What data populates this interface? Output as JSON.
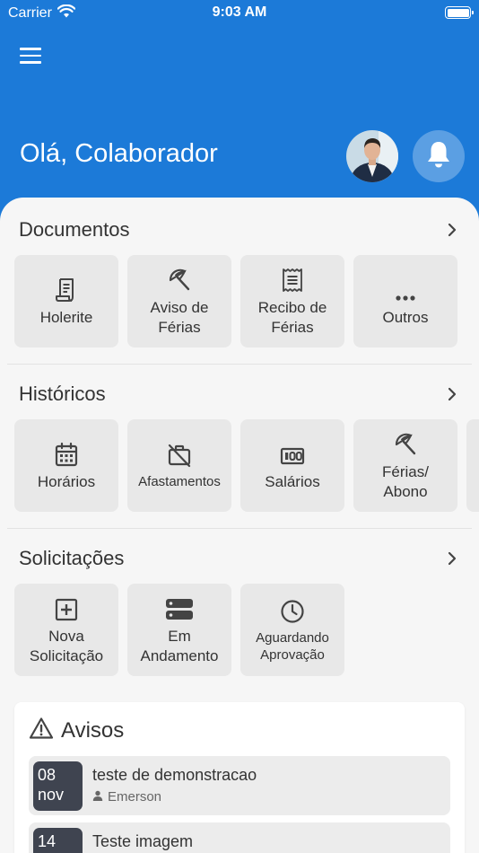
{
  "status_bar": {
    "carrier": "Carrier",
    "time": "9:03 AM"
  },
  "header": {
    "greeting": "Olá, Colaborador"
  },
  "sections": {
    "documentos": {
      "title": "Documentos",
      "tiles": [
        {
          "label": "Holerite",
          "icon": "receipt-icon"
        },
        {
          "label": "Aviso de\nFérias",
          "icon": "beach-umbrella-icon"
        },
        {
          "label": "Recibo de\nFérias",
          "icon": "document-list-icon"
        },
        {
          "label": "Outros",
          "icon": "more-dots-icon"
        }
      ]
    },
    "historicos": {
      "title": "Históricos",
      "tiles": [
        {
          "label": "Horários",
          "icon": "calendar-icon"
        },
        {
          "label": "Afastamentos",
          "icon": "briefcase-off-icon"
        },
        {
          "label": "Salários",
          "icon": "money-icon"
        },
        {
          "label": "Férias/\nAbono",
          "icon": "beach-umbrella-icon"
        }
      ]
    },
    "solicitacoes": {
      "title": "Solicitações",
      "tiles": [
        {
          "label": "Nova\nSolicitação",
          "icon": "plus-square-icon"
        },
        {
          "label": "Em\nAndamento",
          "icon": "server-icon"
        },
        {
          "label": "Aguardando\nAprovação",
          "icon": "clock-icon"
        }
      ]
    }
  },
  "avisos": {
    "title": "Avisos",
    "items": [
      {
        "day": "08",
        "month": "nov",
        "title": "teste de demonstracao",
        "author": "Emerson"
      },
      {
        "day": "14",
        "month": "",
        "title": "Teste imagem",
        "author": ""
      }
    ]
  },
  "colors": {
    "primary": "#1c7ad8",
    "background": "#f6f6f6",
    "tile": "#e8e8e8",
    "date_box": "#3f4450"
  }
}
